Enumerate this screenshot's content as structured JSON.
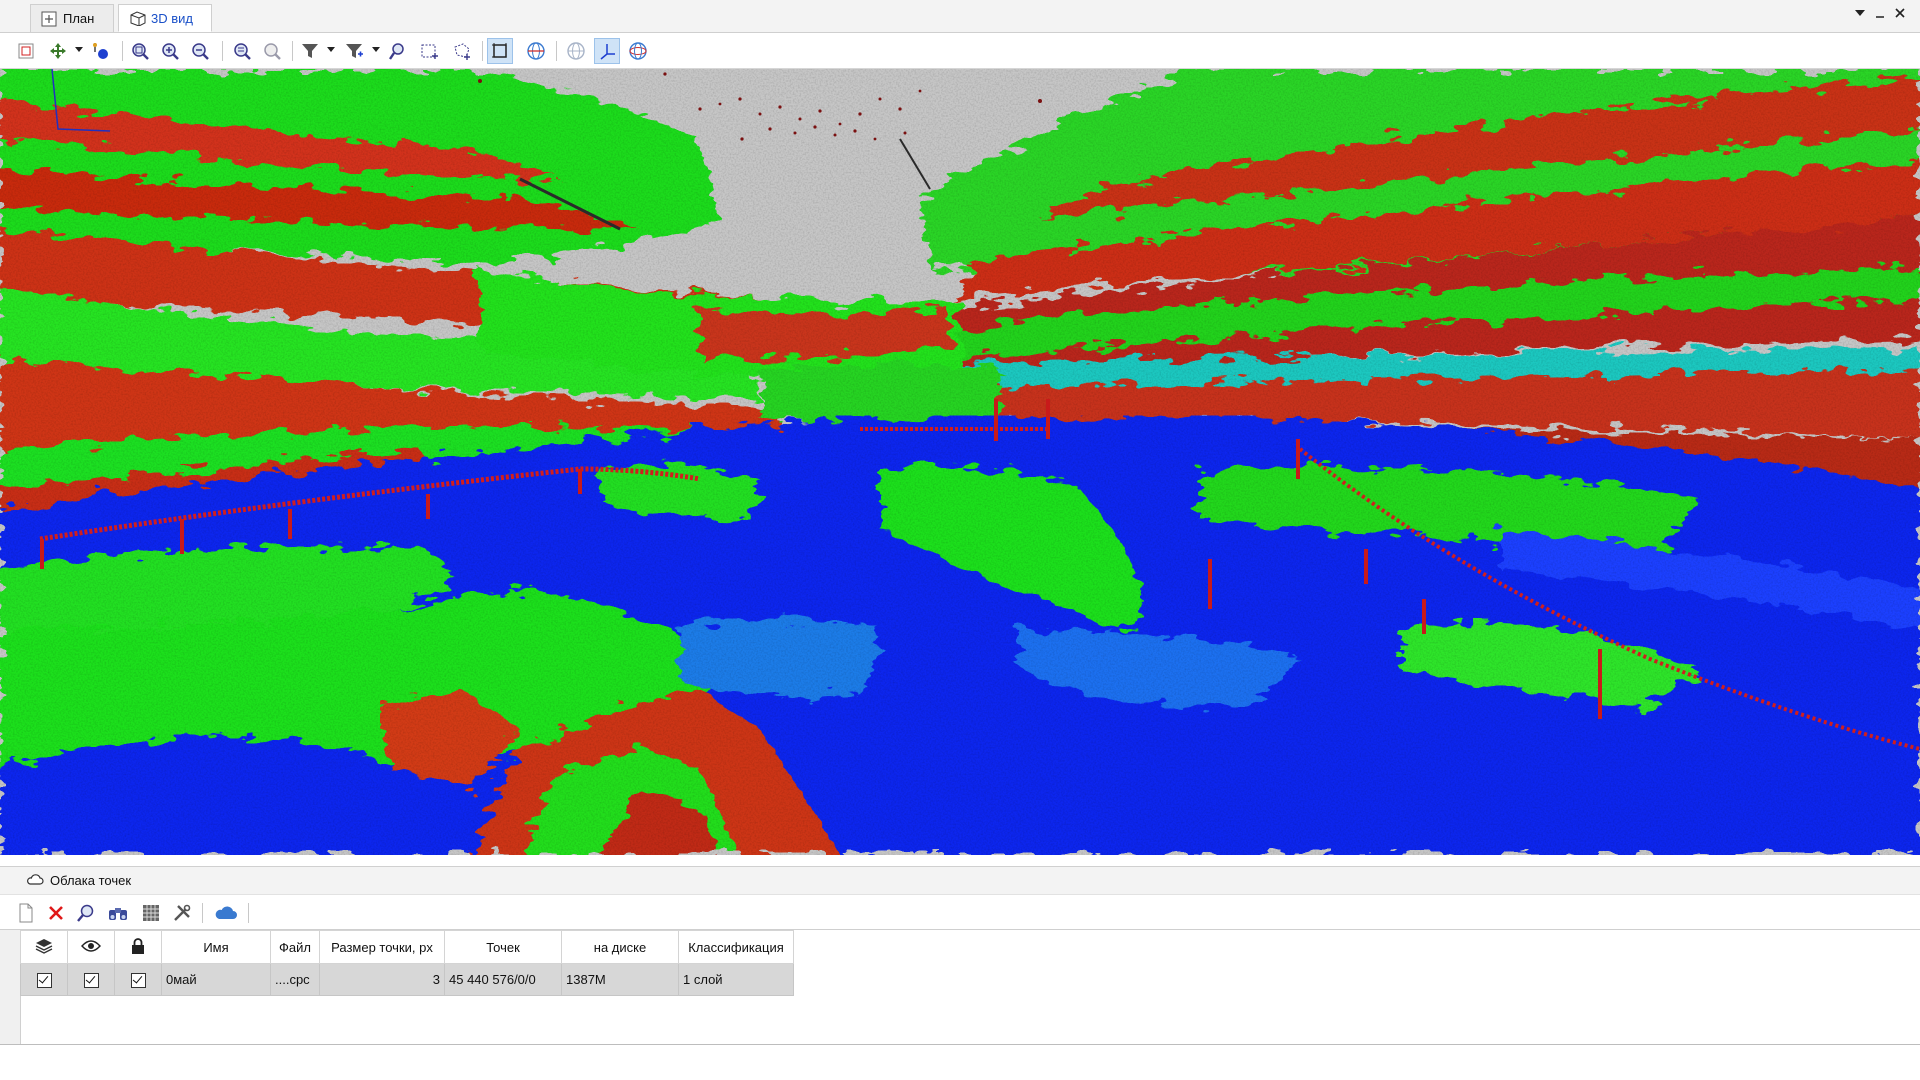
{
  "tabs": [
    {
      "label": "План",
      "icon": "plan-icon",
      "active": false
    },
    {
      "label": "3D вид",
      "icon": "cube-icon",
      "active": true
    }
  ],
  "window_controls": [
    "dropdown-arrow-icon",
    "minimize-icon",
    "close-icon"
  ],
  "toolbar": {
    "icons": [
      "select-frame-icon",
      "camera-navigation-icon",
      "point-marker-icon",
      "zoom-extents-icon",
      "zoom-in-icon",
      "zoom-out-icon",
      "zoom-window-icon",
      "zoom-window-disabled-icon",
      "filter-icon",
      "filter-add-icon",
      "zoom-selection-icon",
      "select-rectangle-icon",
      "select-polygon-icon",
      "bounding-box-icon",
      "globe-wireframe-icon",
      "globe-disabled-icon",
      "axes-icon",
      "globe-orbit-icon"
    ],
    "pressed": [
      "bounding-box-icon",
      "axes-icon"
    ]
  },
  "panel": {
    "title": "Облака точек",
    "title_icon": "cloud-outline-icon",
    "toolbar_icons": [
      "new-file-icon",
      "delete-icon",
      "search-icon",
      "binoculars-icon",
      "table-icon",
      "tools-icon",
      "cloud-icon"
    ]
  },
  "grid": {
    "header_icons": [
      "layers-icon",
      "eye-icon",
      "lock-icon"
    ],
    "columns": [
      "Имя",
      "Файл",
      "Размер точки, px",
      "Точек",
      "на диске",
      "Классификация"
    ],
    "rows": [
      {
        "layers": true,
        "visible": true,
        "locked": true,
        "name": "0май",
        "file": "....cpc",
        "point_size": "3",
        "points": "45 440 576/0/0",
        "disk": "1387M",
        "classification": "1 слой"
      }
    ]
  },
  "colors": {
    "accent_blue": "#1a50c8",
    "cloud_green": "#22e01e",
    "cloud_red": "#d82a10",
    "cloud_blue": "#0a26f0",
    "sky_gray": "#c6c6c6"
  }
}
